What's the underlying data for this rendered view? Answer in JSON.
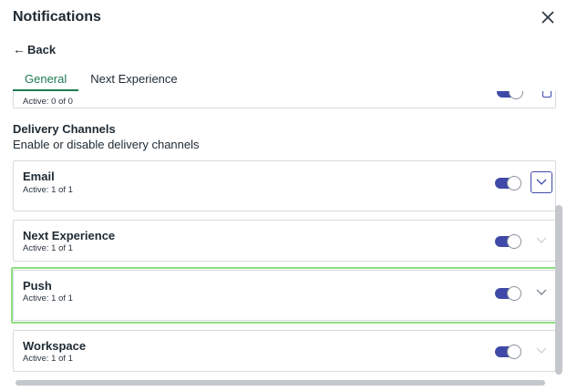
{
  "header": {
    "title": "Notifications",
    "close_icon": "close-icon"
  },
  "nav": {
    "back_label": "Back",
    "back_icon": "arrow-left-icon"
  },
  "tabs": [
    {
      "label": "General",
      "active": true
    },
    {
      "label": "Next Experience",
      "active": false
    }
  ],
  "partial_card": {
    "sub": "Active: 0 of 0"
  },
  "section": {
    "title": "Delivery Channels",
    "subtitle": "Enable or disable delivery channels"
  },
  "channels": [
    {
      "name": "Email",
      "sub": "Active: 1 of 1",
      "enabled": true
    },
    {
      "name": "Next Experience",
      "sub": "Active: 1 of 1",
      "enabled": true
    },
    {
      "name": "Push",
      "sub": "Active: 1 of 1",
      "enabled": true
    },
    {
      "name": "Workspace",
      "sub": "Active: 1 of 1",
      "enabled": true
    }
  ],
  "colors": {
    "accent": "#1f7a52",
    "toggle_on": "#3f4aa8",
    "highlight": "#8fe07f",
    "border": "#d6dbe0"
  }
}
